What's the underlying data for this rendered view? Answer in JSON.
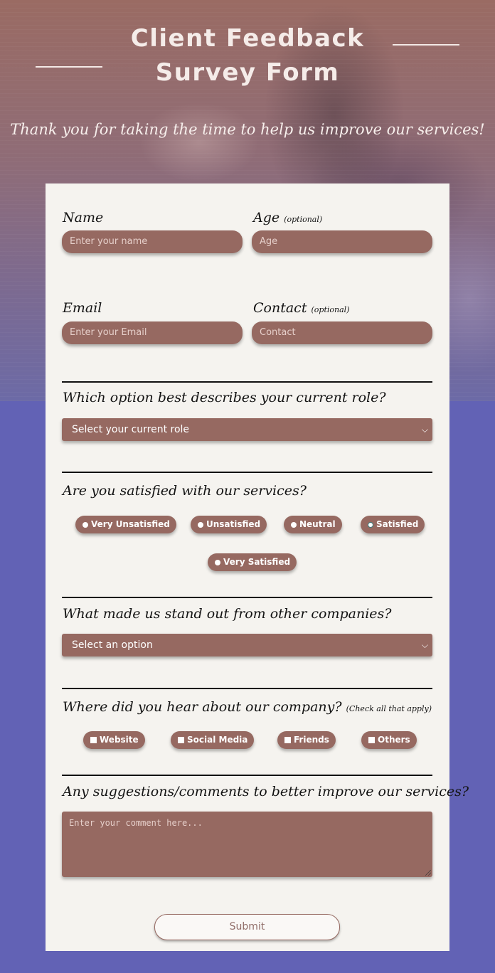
{
  "header": {
    "title_line1": "Client Feedback",
    "title_line2": "Survey Form",
    "subtitle": "Thank you for taking the time to help us improve our services!"
  },
  "form": {
    "name": {
      "label": "Name",
      "placeholder": "Enter your name"
    },
    "age": {
      "label": "Age",
      "optional": "(optional)",
      "placeholder": "Age"
    },
    "email": {
      "label": "Email",
      "placeholder": "Enter your Email"
    },
    "contact": {
      "label": "Contact",
      "optional": "(optional)",
      "placeholder": "Contact"
    },
    "role": {
      "question": "Which option best describes your current role?",
      "selected": "Select your current role"
    },
    "satisfaction": {
      "question": "Are you satisfied with our services?",
      "options": [
        "Very Unsatisfied",
        "Unsatisfied",
        "Neutral",
        "Satisfied",
        "Very Satisfied"
      ],
      "selected": "Satisfied"
    },
    "standout": {
      "question": "What made us stand out from other companies?",
      "selected": "Select an option"
    },
    "source": {
      "question": "Where did you hear about our company?",
      "note": "(Check all that apply)",
      "options": [
        "Website",
        "Social Media",
        "Friends",
        "Others"
      ]
    },
    "comments": {
      "question": "Any suggestions/comments to better improve our services?",
      "placeholder": "Enter your comment here..."
    },
    "submit_label": "Submit"
  },
  "colors": {
    "field_bg": "#966961",
    "card_bg": "#f5f3ef",
    "page_bg": "#6262b5"
  }
}
